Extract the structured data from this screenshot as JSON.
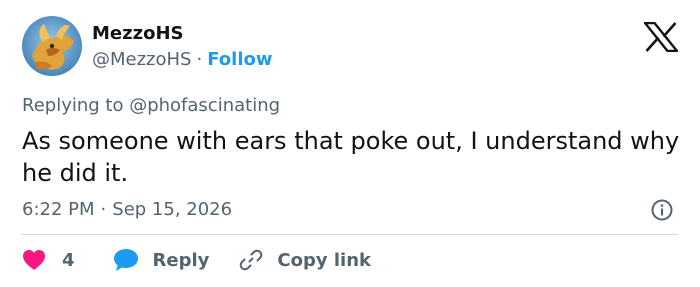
{
  "author": {
    "display_name": "MezzoHS",
    "handle": "@MezzoHS",
    "separator": "·",
    "follow_label": "Follow"
  },
  "replying_to": {
    "prefix": "Replying to ",
    "mention": "@phofascinating"
  },
  "tweet": {
    "text": "As someone with ears that poke out, I understand why he did it.",
    "time": "6:22 PM",
    "separator": "·",
    "date": "Sep 15, 2026"
  },
  "actions": {
    "like_count": "4",
    "reply_label": "Reply",
    "copy_link_label": "Copy link"
  },
  "icons": {
    "brand": "x-logo-icon",
    "info": "info-icon",
    "like": "heart-icon",
    "reply": "speech-bubble-icon",
    "copy": "link-icon"
  },
  "colors": {
    "text": "#0f1419",
    "secondary": "#536471",
    "accent": "#1d9bf0",
    "like": "#f91880",
    "divider": "#cfd9de"
  }
}
